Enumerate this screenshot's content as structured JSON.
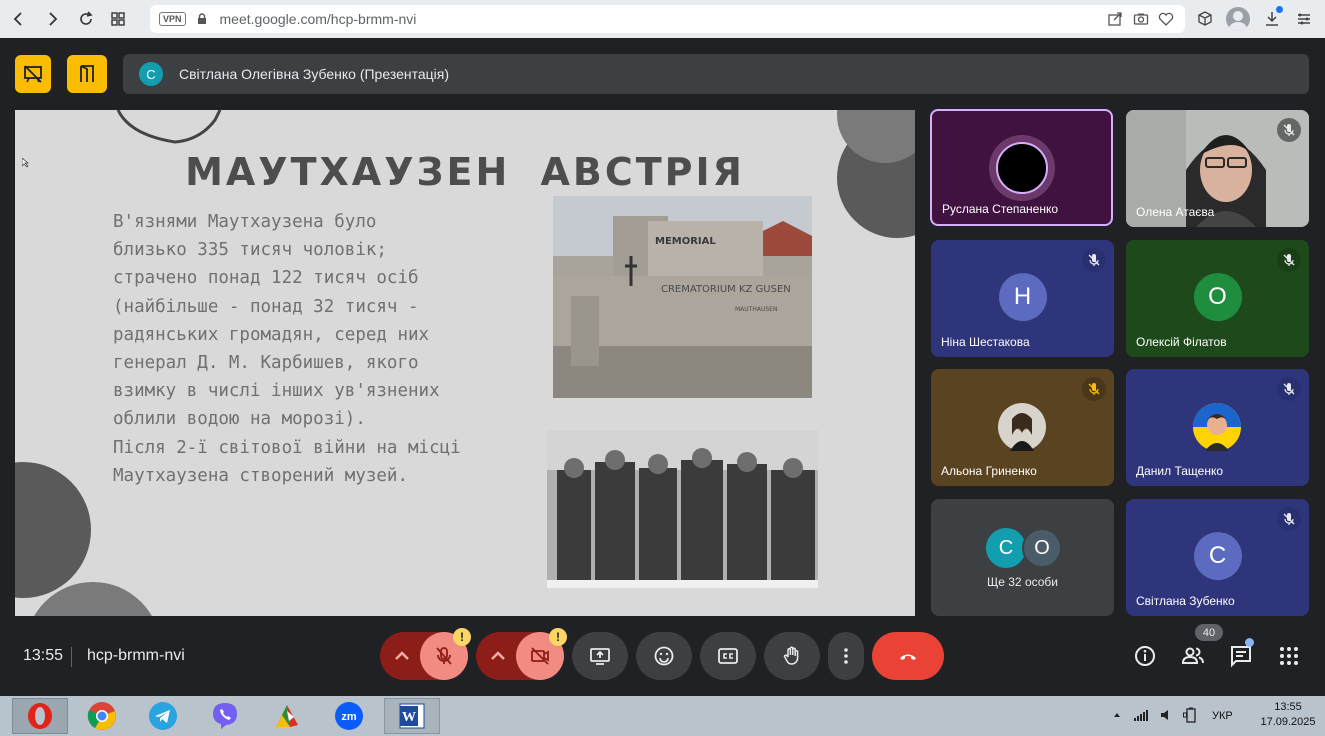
{
  "browser": {
    "vpn_label": "VPN",
    "url": "meet.google.com/hcp-brmm-nvi"
  },
  "presenter": {
    "avatar_letter": "С",
    "name": "Світлана Олегівна Зубенко (Презентація)"
  },
  "slide": {
    "title": "МАУТХАУЗЕН АВСТРІЯ",
    "body": "В'язнями Маутхаузена було\nблизько 335 тисяч чоловік;\nстрачено понад 122 тисяч осіб\n(найбільше - понад 32 тисяч -\nрадянських громадян, серед них\nгенерал Д. М. Карбишев, якого\nвзимку в числі інших ув'язнених\nоблили водою на морозі).\nПісля 2-ї світової війни на місці\nМаутхаузена створений музей.",
    "photo1_text_top": "MEMORIAL",
    "photo1_text_wall": "CREMATORIUM KZ GUSEN",
    "photo1_text_wall2": "MAUTHAUSEN"
  },
  "participants": [
    {
      "name": "Руслана Степаненко",
      "active": true
    },
    {
      "name": "Олена Атаєва"
    },
    {
      "name": "Ніна Шестакова",
      "letter": "Н",
      "color": "#5c6bc0"
    },
    {
      "name": "Олексій Філатов",
      "letter": "О",
      "color": "#1e8e3e"
    },
    {
      "name": "Альона Гриненко"
    },
    {
      "name": "Данил Тащенко"
    },
    {
      "name": "Світлана Зубенко",
      "letter": "С",
      "color": "#5c6bc0"
    }
  ],
  "more": {
    "letters": [
      "С",
      "О"
    ],
    "label": "Ще 32 особи"
  },
  "bottom": {
    "time": "13:55",
    "meeting_code": "hcp-brmm-nvi",
    "participant_count": "40",
    "warn_mark": "!"
  },
  "taskbar": {
    "lang": "УКР",
    "time": "13:55",
    "date": "17.09.2025"
  },
  "colors": {
    "yellow": "#fbbc04",
    "end_call": "#ea4335",
    "muted_bg": "#f28b82",
    "muted_dark": "#8c1d18",
    "active_border": "#d7aefb"
  }
}
